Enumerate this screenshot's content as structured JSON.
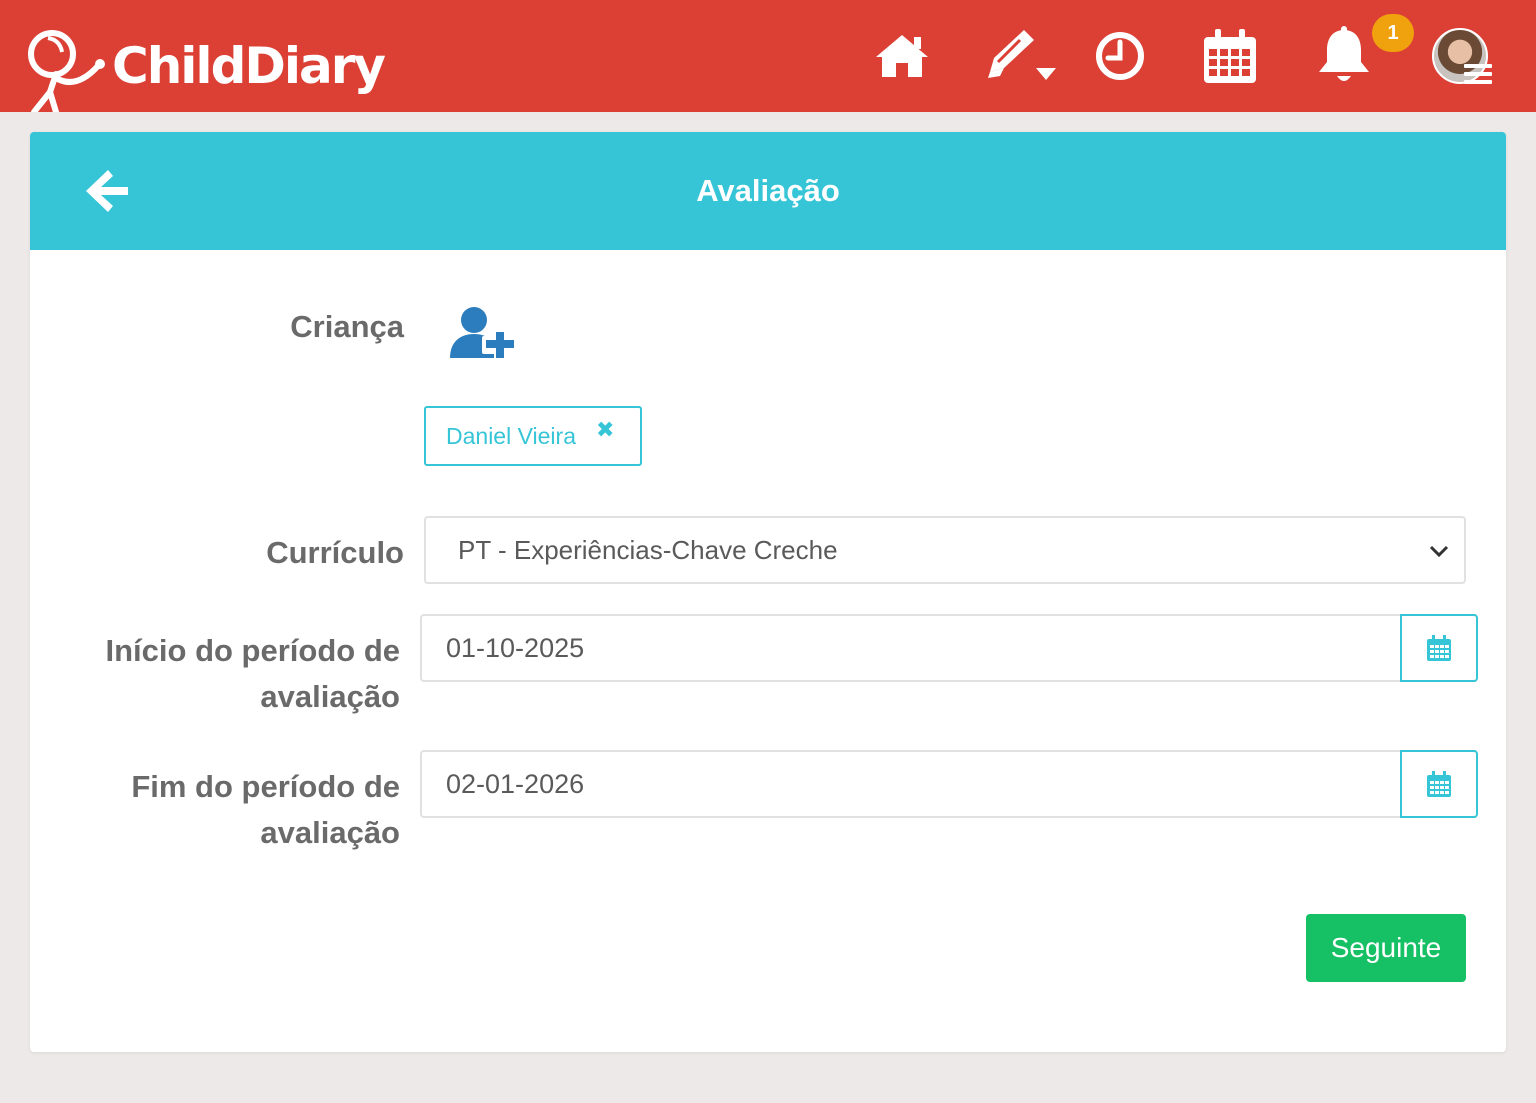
{
  "brand": {
    "name": "ChildDiary",
    "primary_color": "#dc4035",
    "accent_color": "#36c5d6",
    "success_color": "#16c064",
    "badge_color": "#f0a20e"
  },
  "topbar": {
    "icons": [
      "home-icon",
      "pencil-icon",
      "clock-icon",
      "calendar-icon",
      "bell-icon"
    ],
    "notification_count": "1"
  },
  "page": {
    "title": "Avaliação"
  },
  "form": {
    "child": {
      "label": "Criança",
      "selected": [
        {
          "name": "Daniel Vieira",
          "remove": "✖"
        }
      ]
    },
    "curriculum": {
      "label": "Currículo",
      "value": "PT - Experiências-Chave Creche"
    },
    "start": {
      "label_line1": "Início do período de",
      "label_line2": "avaliação",
      "value": "01-10-2025"
    },
    "end": {
      "label_line1": "Fim do período de",
      "label_line2": "avaliação",
      "value": "02-01-2026"
    },
    "next_label": "Seguinte"
  }
}
